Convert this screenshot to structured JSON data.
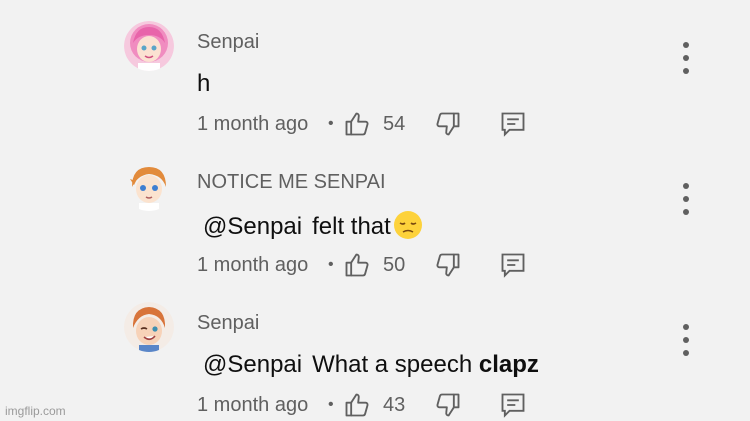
{
  "comments": [
    {
      "author": "Senpai",
      "mention": "",
      "text": "h",
      "bold_text": "",
      "emoji": "",
      "time": "1 month ago",
      "likes": "54",
      "avatar": "pink-haired-girl-avatar"
    },
    {
      "author": "NOTICE ME SENPAI",
      "mention": "@Senpai",
      "text": "felt that",
      "bold_text": "",
      "emoji": "pensive-face-emoji",
      "time": "1 month ago",
      "likes": "50",
      "avatar": "orange-haired-boy-avatar"
    },
    {
      "author": "Senpai",
      "mention": "@Senpai",
      "text": "What a speech ",
      "bold_text": "clapz",
      "emoji": "",
      "time": "1 month ago",
      "likes": "43",
      "avatar": "ginger-boy-avatar"
    }
  ],
  "separator": "•",
  "icons": {
    "like": "thumbs-up-icon",
    "dislike": "thumbs-down-icon",
    "reply": "reply-comment-icon",
    "more": "more-vertical-icon"
  },
  "watermark": "imgflip.com",
  "colors": {
    "background": "#f2f2f2",
    "author": "#606060",
    "text": "#0f0f0f",
    "icon": "#606060"
  }
}
